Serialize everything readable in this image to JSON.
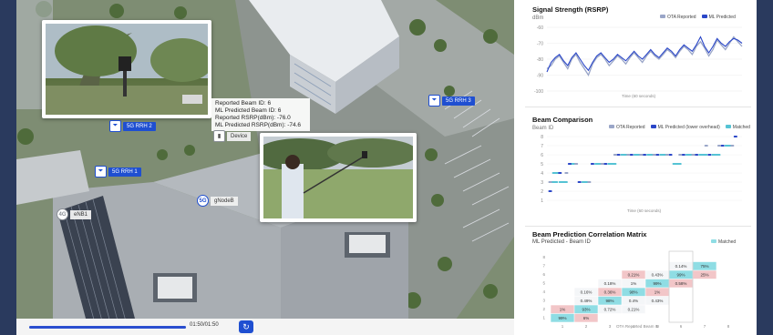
{
  "map": {
    "video_card": {},
    "beam_info": [
      "Reported Beam ID: 6",
      "ML Predicted Beam ID: 6",
      "Reported RSRP(dBm): -76.0",
      "ML Predicted RSRP(dBm): -74.6"
    ],
    "pins": {
      "rrh2": "5G RRH 2",
      "rrh1": "5G RRH 1",
      "rrh3": "5G RRH 3",
      "gnode": "gNodeB",
      "gnode_badge": "5G",
      "enb": "eNB1",
      "enb_badge": "4G",
      "device": "Device"
    },
    "playback": {
      "time": "01:50/01:50",
      "progress": 1.0
    }
  },
  "signal": {
    "title": "Signal Strength (RSRP)",
    "unit": "dBm",
    "legend": [
      "OTA Reported",
      "ML Predicted"
    ],
    "yticks": [
      "-60",
      "-70",
      "-80",
      "-90",
      "-100"
    ],
    "xlabel": "Time (60 seconds)",
    "colors": {
      "ota": "#9aa6c8",
      "ml": "#2b47c8"
    }
  },
  "beam": {
    "title": "Beam Comparison",
    "unit": "Beam ID",
    "legend": [
      "OTA Reported",
      "ML Predicted (lower overhead)",
      "Matched"
    ],
    "yticks": [
      "8",
      "7",
      "6",
      "5",
      "4",
      "3",
      "2",
      "1"
    ],
    "xlabel": "Time (60 seconds)",
    "colors": {
      "ota": "#9aa6c8",
      "ml": "#2b47c8",
      "matched": "#55c3d4"
    }
  },
  "matrix": {
    "title": "Beam Prediction Correlation Matrix",
    "ylabel": "ML Predicted - Beam ID",
    "legend": "Matched",
    "xlabel": "OTA Reported Beam ID",
    "ticks": [
      "1",
      "2",
      "3",
      "4",
      "5",
      "6",
      "7",
      "8"
    ],
    "cells": [
      {
        "r": 7,
        "c": 6,
        "v": "0.14%",
        "t": "plain"
      },
      {
        "r": 7,
        "c": 7,
        "v": "75%",
        "t": "match"
      },
      {
        "r": 6,
        "c": 4,
        "v": "0.21%",
        "t": "off"
      },
      {
        "r": 6,
        "c": 5,
        "v": "0.43%",
        "t": "plain"
      },
      {
        "r": 6,
        "c": 6,
        "v": "99%",
        "t": "match"
      },
      {
        "r": 6,
        "c": 7,
        "v": "25%",
        "t": "off"
      },
      {
        "r": 5,
        "c": 3,
        "v": "0.18%",
        "t": "plain"
      },
      {
        "r": 5,
        "c": 4,
        "v": "1%",
        "t": "plain"
      },
      {
        "r": 5,
        "c": 5,
        "v": "99%",
        "t": "match"
      },
      {
        "r": 5,
        "c": 6,
        "v": "0.58%",
        "t": "off"
      },
      {
        "r": 4,
        "c": 2,
        "v": "0.16%",
        "t": "plain"
      },
      {
        "r": 4,
        "c": 3,
        "v": "0.36%",
        "t": "off"
      },
      {
        "r": 4,
        "c": 4,
        "v": "98%",
        "t": "match"
      },
      {
        "r": 4,
        "c": 5,
        "v": "1%",
        "t": "off"
      },
      {
        "r": 3,
        "c": 2,
        "v": "0.49%",
        "t": "plain"
      },
      {
        "r": 3,
        "c": 3,
        "v": "98%",
        "t": "match"
      },
      {
        "r": 3,
        "c": 4,
        "v": "0.4%",
        "t": "plain"
      },
      {
        "r": 3,
        "c": 5,
        "v": "0.43%",
        "t": "plain"
      },
      {
        "r": 2,
        "c": 1,
        "v": "1%",
        "t": "off"
      },
      {
        "r": 2,
        "c": 2,
        "v": "93%",
        "t": "match"
      },
      {
        "r": 2,
        "c": 3,
        "v": "0.72%",
        "t": "plain"
      },
      {
        "r": 2,
        "c": 4,
        "v": "0.21%",
        "t": "plain"
      },
      {
        "r": 1,
        "c": 1,
        "v": "99%",
        "t": "match"
      },
      {
        "r": 1,
        "c": 2,
        "v": "6%",
        "t": "off"
      }
    ],
    "colors": {
      "match": "#8fdde4",
      "off": "#f2c6c8",
      "plain": "#f4f6f8"
    }
  },
  "chart_data": [
    {
      "type": "line",
      "title": "Signal Strength (RSRP)",
      "ylabel": "dBm",
      "xlabel": "Time (60 seconds)",
      "ylim": [
        -100,
        -60
      ],
      "legend": "top-right",
      "series": [
        {
          "name": "OTA Reported",
          "values": [
            -86,
            -84,
            -80,
            -78,
            -82,
            -86,
            -80,
            -77,
            -82,
            -86,
            -90,
            -83,
            -79,
            -77,
            -80,
            -84,
            -81,
            -78,
            -80,
            -83,
            -79,
            -76,
            -79,
            -82,
            -78,
            -75,
            -78,
            -80,
            -77,
            -74,
            -76,
            -79,
            -75,
            -72,
            -74,
            -77,
            -72,
            -69,
            -73,
            -78,
            -74,
            -68,
            -71,
            -74,
            -70,
            -66,
            -69,
            -72
          ]
        },
        {
          "name": "ML Predicted",
          "values": [
            -88,
            -82,
            -79,
            -77,
            -81,
            -84,
            -79,
            -76,
            -80,
            -84,
            -87,
            -82,
            -78,
            -76,
            -79,
            -82,
            -80,
            -77,
            -79,
            -81,
            -78,
            -75,
            -78,
            -80,
            -77,
            -74,
            -77,
            -79,
            -76,
            -73,
            -75,
            -78,
            -74,
            -71,
            -73,
            -75,
            -71,
            -66,
            -72,
            -76,
            -72,
            -67,
            -70,
            -72,
            -69,
            -67,
            -68,
            -70
          ]
        }
      ]
    },
    {
      "type": "scatter",
      "title": "Beam Comparison",
      "ylabel": "Beam ID",
      "xlabel": "Time (60 seconds)",
      "ylim": [
        1,
        8
      ],
      "legend": "top-right",
      "series": [
        {
          "name": "Matched",
          "values": [
            [
              2,
              3
            ],
            [
              3,
              4
            ],
            [
              5,
              3
            ],
            [
              8,
              5
            ],
            [
              12,
              3
            ],
            [
              16,
              5
            ],
            [
              20,
              5
            ],
            [
              24,
              6
            ],
            [
              28,
              6
            ],
            [
              32,
              6
            ],
            [
              36,
              6
            ],
            [
              40,
              5
            ],
            [
              44,
              6
            ],
            [
              48,
              6
            ],
            [
              52,
              6
            ],
            [
              56,
              7
            ]
          ]
        },
        {
          "name": "ML Predicted (lower overhead)",
          "values": [
            [
              1,
              2
            ],
            [
              4,
              4
            ],
            [
              7,
              5
            ],
            [
              10,
              3
            ],
            [
              14,
              5
            ],
            [
              18,
              5
            ],
            [
              22,
              6
            ],
            [
              26,
              6
            ],
            [
              30,
              6
            ],
            [
              34,
              6
            ],
            [
              38,
              6
            ],
            [
              42,
              6
            ],
            [
              46,
              6
            ],
            [
              50,
              6
            ],
            [
              54,
              7
            ],
            [
              58,
              8
            ]
          ]
        },
        {
          "name": "OTA Reported",
          "values": [
            [
              1,
              3
            ],
            [
              6,
              4
            ],
            [
              9,
              5
            ],
            [
              13,
              3
            ],
            [
              17,
              5
            ],
            [
              21,
              6
            ],
            [
              25,
              6
            ],
            [
              29,
              6
            ],
            [
              33,
              6
            ],
            [
              37,
              6
            ],
            [
              41,
              6
            ],
            [
              45,
              6
            ],
            [
              49,
              7
            ],
            [
              53,
              7
            ],
            [
              57,
              7
            ]
          ]
        }
      ]
    },
    {
      "type": "heatmap",
      "title": "Beam Prediction Correlation Matrix",
      "xlabel": "OTA Reported Beam ID",
      "ylabel": "ML Predicted - Beam ID",
      "x": [
        "1",
        "2",
        "3",
        "4",
        "5",
        "6",
        "7",
        "8"
      ],
      "y": [
        "1",
        "2",
        "3",
        "4",
        "5",
        "6",
        "7",
        "8"
      ]
    }
  ]
}
